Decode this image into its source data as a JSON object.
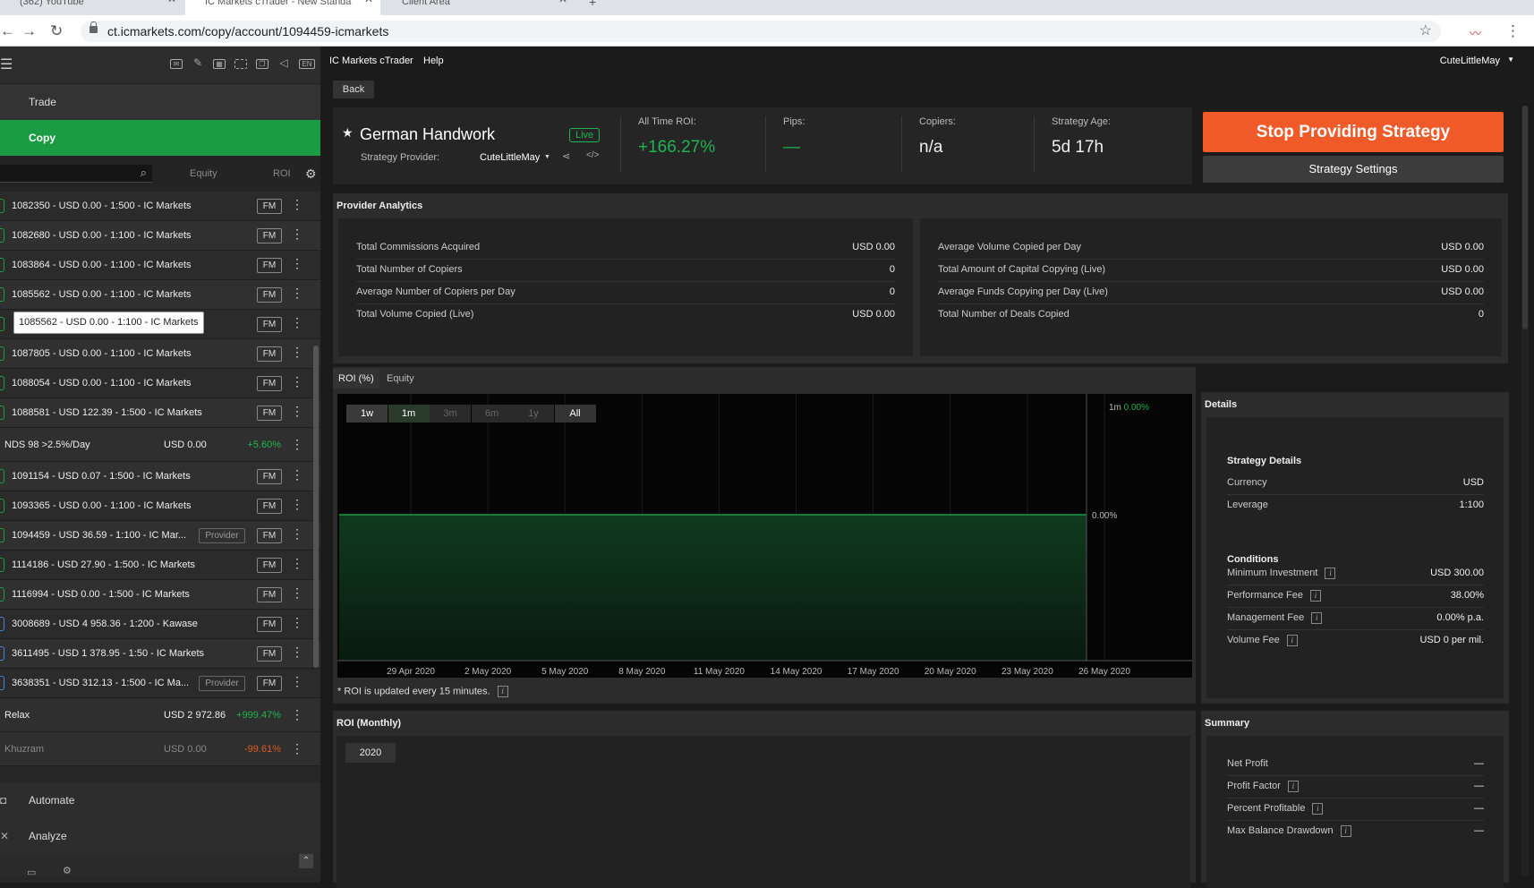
{
  "browser": {
    "tabs": [
      {
        "label": "(362) YouTube"
      },
      {
        "label": "IC Markets cTrader - New Standa"
      },
      {
        "label": "Client Area"
      }
    ],
    "url": "ct.icmarkets.com/copy/account/1094459-icmarkets"
  },
  "colors": {
    "accent_green": "#1a9b44",
    "roi_positive": "#1fb451",
    "stop_button": "#f05a28",
    "negative": "#e05a20"
  },
  "sidebar": {
    "toolbar_icons": [
      "envelope-icon",
      "tag-icon",
      "calendar-icon",
      "screenshot-icon",
      "layers-icon",
      "volume-icon",
      "language-icon"
    ],
    "language": "EN",
    "nav": {
      "trade": "Trade",
      "copy": "Copy",
      "automate": "Automate",
      "analyze": "Analyze"
    },
    "filter": {
      "equity": "Equity",
      "roi": "ROI"
    },
    "fm_label": "FM",
    "provider_label": "Provider",
    "tooltip": "1085562 - USD 0.00 - 1:100 - IC Markets",
    "items": [
      {
        "kind": "account",
        "label": "1082350 - USD 0.00 - 1:500 - IC Markets"
      },
      {
        "kind": "account",
        "label": "1082680 - USD 0.00 - 1:100 - IC Markets"
      },
      {
        "kind": "account",
        "label": "1083864 - USD 0.00 - 1:100 - IC Markets"
      },
      {
        "kind": "account",
        "label": "1085562 - USD 0.00 - 1:100 - IC Markets"
      },
      {
        "kind": "account",
        "label": ""
      },
      {
        "kind": "account",
        "label": "1087805 - USD 0.00 - 1:100 - IC Markets"
      },
      {
        "kind": "account",
        "label": "1088054 - USD 0.00 - 1:100 - IC Markets"
      },
      {
        "kind": "account",
        "label": "1088581 - USD 122.39 - 1:500 - IC Markets"
      },
      {
        "kind": "strategy",
        "name": "NDS 98 >2.5%/Day",
        "equity": "USD 0.00",
        "roi": "+5.60%"
      },
      {
        "kind": "account",
        "label": "1091154 - USD 0.07 - 1:500 - IC Markets"
      },
      {
        "kind": "account",
        "label": "1093365 - USD 0.00 - 1:100 - IC Markets"
      },
      {
        "kind": "account",
        "label": "1094459 - USD 36.59 - 1:100 - IC Mar...",
        "provider": true
      },
      {
        "kind": "account",
        "label": "1114186 - USD 27.90 - 1:500 - IC Markets"
      },
      {
        "kind": "account",
        "label": "1116994 - USD 0.00 - 1:500 - IC Markets"
      },
      {
        "kind": "account",
        "label": "3008689 - USD 4 958.36 - 1:200 - Kawase",
        "blue": true
      },
      {
        "kind": "account",
        "label": "3611495 - USD 1 378.95 - 1:50 - IC Markets",
        "blue": true
      },
      {
        "kind": "account",
        "label": "3638351 - USD 312.13 - 1:500 - IC Ma...",
        "provider": true,
        "blue": true
      },
      {
        "kind": "strategy",
        "name": "Relax",
        "equity": "USD 2 972.86",
        "roi": "+999.47%"
      },
      {
        "kind": "strategy",
        "name": "Khuzram",
        "equity": "USD 0.00",
        "roi": "-99.61%",
        "dim": true
      }
    ]
  },
  "topbar": {
    "app": "IC Markets cTrader",
    "help": "Help",
    "user": "CuteLittleMay"
  },
  "back": "Back",
  "strategy": {
    "name": "German Handwork",
    "status": "Live",
    "provider_label": "Strategy Provider:",
    "provider": "CuteLittleMay",
    "roi_label": "All Time ROI:",
    "roi": "+166.27%",
    "pips_label": "Pips:",
    "pips": "—",
    "copiers_label": "Copiers:",
    "copiers": "n/a",
    "age_label": "Strategy Age:",
    "age": "5d 17h",
    "stop_btn": "Stop Providing Strategy",
    "settings_btn": "Strategy Settings"
  },
  "analytics": {
    "title": "Provider Analytics",
    "left": [
      {
        "k": "Total Commissions Acquired",
        "v": "USD 0.00"
      },
      {
        "k": "Total Number of Copiers",
        "v": "0"
      },
      {
        "k": "Average Number of Copiers per Day",
        "v": "0"
      },
      {
        "k": "Total Volume Copied (Live)",
        "v": "USD 0.00"
      }
    ],
    "right": [
      {
        "k": "Average Volume Copied per Day",
        "v": "USD 0.00"
      },
      {
        "k": "Total Amount of Capital Copying (Live)",
        "v": "USD 0.00"
      },
      {
        "k": "Average Funds Copying per Day (Live)",
        "v": "USD 0.00"
      },
      {
        "k": "Total Number of Deals Copied",
        "v": "0"
      }
    ]
  },
  "chart_tabs": {
    "roi": "ROI (%)",
    "equity": "Equity"
  },
  "chart_data": {
    "type": "area",
    "periods": [
      "1w",
      "1m",
      "3m",
      "6m",
      "1y",
      "All"
    ],
    "selected_period": "1m",
    "legend_period": "1m",
    "legend_value": "0.00%",
    "y_label": "0.00%",
    "x_ticks": [
      "29 Apr 2020",
      "2 May 2020",
      "5 May 2020",
      "8 May 2020",
      "11 May 2020",
      "14 May 2020",
      "17 May 2020",
      "20 May 2020",
      "23 May 2020",
      "26 May 2020"
    ],
    "series": [
      {
        "values": [
          0,
          0
        ]
      }
    ],
    "line_color": "#1a9b44"
  },
  "roi_note": "* ROI is updated every 15 minutes.",
  "monthly": {
    "title": "ROI (Monthly)",
    "year": "2020"
  },
  "details": {
    "title": "Details",
    "strategy_details": "Strategy Details",
    "rows1": [
      {
        "k": "Currency",
        "v": "USD"
      },
      {
        "k": "Leverage",
        "v": "1:100"
      }
    ],
    "conditions": "Conditions",
    "rows2": [
      {
        "k": "Minimum Investment",
        "v": "USD 300.00"
      },
      {
        "k": "Performance Fee",
        "v": "38.00%"
      },
      {
        "k": "Management Fee",
        "v": "0.00% p.a."
      },
      {
        "k": "Volume Fee",
        "v": "USD 0 per mil."
      }
    ]
  },
  "summary": {
    "title": "Summary",
    "rows": [
      {
        "k": "Net Profit",
        "v": "—"
      },
      {
        "k": "Profit Factor",
        "v": "—"
      },
      {
        "k": "Percent Profitable",
        "v": "—"
      },
      {
        "k": "Max Balance Drawdown",
        "v": "—"
      }
    ]
  }
}
